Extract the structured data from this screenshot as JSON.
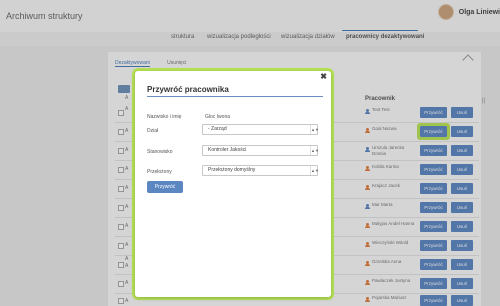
{
  "header": {
    "app_title": "Archiwum struktury",
    "user_name": "Olga Liniewi"
  },
  "nav_tabs": [
    "struktura",
    "wizualizacja podległości",
    "wizualizacja działów",
    "pracownicy dezaktywowani"
  ],
  "sub_tabs": [
    "Dezaktywowani",
    "Usunięci"
  ],
  "table": {
    "header": "Pracownik",
    "side_letters": [
      "A",
      "A",
      "A",
      "A",
      "A",
      "A",
      "A",
      "A",
      "A",
      "A",
      "A",
      "A",
      "A"
    ],
    "rows": [
      {
        "name": "Test Test",
        "icon": "person-icon-blue"
      },
      {
        "name": "Goal Nazwa",
        "icon": "person-icon-orange"
      },
      {
        "name": "Urszula Jarecka Dosnia",
        "icon": "person-icon-blue"
      },
      {
        "name": "Kobila Karina",
        "icon": "person-icon-orange"
      },
      {
        "name": "Krajacz Jacek",
        "icon": "person-icon-orange"
      },
      {
        "name": "Mar Marta",
        "icon": "person-icon-blue"
      },
      {
        "name": "Malyjas Andel Hanna",
        "icon": "person-icon-orange"
      },
      {
        "name": "Wieczyński Witold",
        "icon": "person-icon-orange"
      },
      {
        "name": "Grzelska Anna",
        "icon": "person-icon-orange"
      },
      {
        "name": "Pawlaczek Justyna",
        "icon": "person-icon-orange"
      },
      {
        "name": "Pojarska Mariusz",
        "icon": "person-icon-orange"
      }
    ],
    "restore_label": "Przywróć",
    "delete_label": "Usuń"
  },
  "scroll_indicator": "||",
  "modal": {
    "title": "Przywróć pracownika",
    "close_glyph": "✖",
    "fields": [
      {
        "label": "Nazwisko i imię",
        "type": "text",
        "value": "Gloc Iwona"
      },
      {
        "label": "Dział",
        "type": "select",
        "value": "- Zarząd"
      },
      {
        "label": "Stanowisko",
        "type": "select",
        "value": "Kontroler Jakości"
      },
      {
        "label": "Przełożony",
        "type": "select",
        "value": "Przełożony domyślny"
      }
    ],
    "caret_glyph": "▲▼",
    "submit_label": "Przywróć"
  },
  "colors": {
    "accent": "#5b86c2",
    "highlight": "#b8e356",
    "orange_icon": "#e07c3e"
  }
}
